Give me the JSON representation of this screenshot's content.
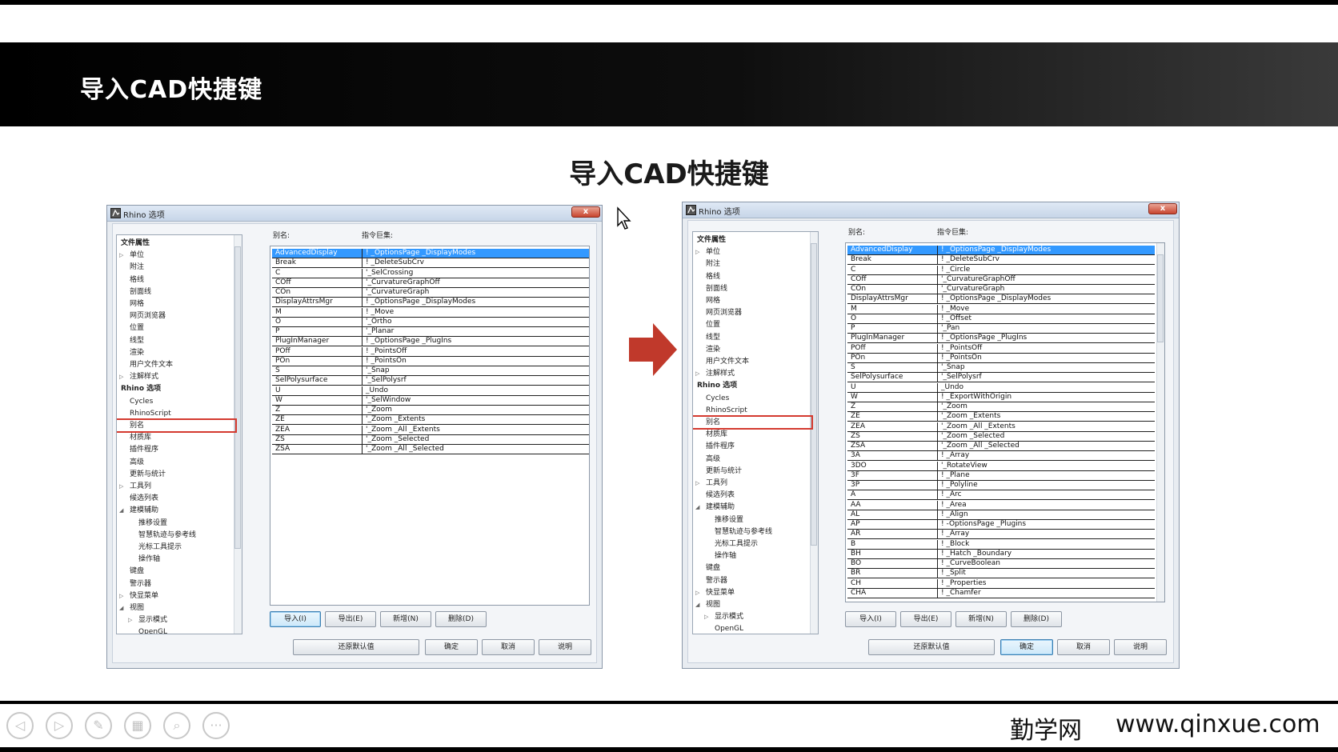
{
  "header": {
    "title": "导入CAD快捷键"
  },
  "slide": {
    "title": "导入CAD快捷键"
  },
  "dialog_title": "Rhino 选项",
  "close_glyph": "x",
  "column_headers": {
    "alias": "别名:",
    "macro": "指令巨集:"
  },
  "tree_items": [
    {
      "label": "文件属性",
      "bold": true
    },
    {
      "label": "单位",
      "indent": 1,
      "expander": "closed"
    },
    {
      "label": "附注",
      "indent": 1
    },
    {
      "label": "格线",
      "indent": 1
    },
    {
      "label": "剖面线",
      "indent": 1
    },
    {
      "label": "网格",
      "indent": 1
    },
    {
      "label": "网页浏览器",
      "indent": 1
    },
    {
      "label": "位置",
      "indent": 1
    },
    {
      "label": "线型",
      "indent": 1
    },
    {
      "label": "渲染",
      "indent": 1
    },
    {
      "label": "用户文件文本",
      "indent": 1
    },
    {
      "label": "注解样式",
      "indent": 1,
      "expander": "closed"
    },
    {
      "label": "Rhino 选项",
      "bold": true
    },
    {
      "label": "Cycles",
      "indent": 1
    },
    {
      "label": "RhinoScript",
      "indent": 1
    },
    {
      "label": "别名",
      "indent": 1,
      "selected": true
    },
    {
      "label": "材质库",
      "indent": 1
    },
    {
      "label": "插件程序",
      "indent": 1
    },
    {
      "label": "高级",
      "indent": 1
    },
    {
      "label": "更新与统计",
      "indent": 1
    },
    {
      "label": "工具列",
      "indent": 1,
      "expander": "closed"
    },
    {
      "label": "候选列表",
      "indent": 1
    },
    {
      "label": "建模辅助",
      "indent": 1,
      "expander": "open"
    },
    {
      "label": "推移设置",
      "indent": 2
    },
    {
      "label": "智慧轨迹与参考线",
      "indent": 2
    },
    {
      "label": "光标工具提示",
      "indent": 2
    },
    {
      "label": "操作轴",
      "indent": 2
    },
    {
      "label": "键盘",
      "indent": 1
    },
    {
      "label": "警示器",
      "indent": 1
    },
    {
      "label": "快显菜单",
      "indent": 1,
      "expander": "closed"
    },
    {
      "label": "视图",
      "indent": 1,
      "expander": "open"
    },
    {
      "label": "显示模式",
      "indent": 2,
      "expander": "closed"
    },
    {
      "label": "OpenGL",
      "indent": 2
    }
  ],
  "left_aliases": [
    [
      "AdvancedDisplay",
      "! _OptionsPage _DisplayModes"
    ],
    [
      "Break",
      "! _DeleteSubCrv"
    ],
    [
      "C",
      "'_SelCrossing"
    ],
    [
      "COff",
      "'_CurvatureGraphOff"
    ],
    [
      "COn",
      "'_CurvatureGraph"
    ],
    [
      "DisplayAttrsMgr",
      "! _OptionsPage _DisplayModes"
    ],
    [
      "M",
      "! _Move"
    ],
    [
      "O",
      "'_Ortho"
    ],
    [
      "P",
      "'_Planar"
    ],
    [
      "PlugInManager",
      "! _OptionsPage _PlugIns"
    ],
    [
      "POff",
      "! _PointsOff"
    ],
    [
      "POn",
      "! _PointsOn"
    ],
    [
      "S",
      "'_Snap"
    ],
    [
      "SelPolysurface",
      "'_SelPolysrf"
    ],
    [
      "U",
      "_Undo"
    ],
    [
      "W",
      "'_SelWindow"
    ],
    [
      "Z",
      "'_Zoom"
    ],
    [
      "ZE",
      "'_Zoom _Extents"
    ],
    [
      "ZEA",
      "'_Zoom _All _Extents"
    ],
    [
      "ZS",
      "'_Zoom _Selected"
    ],
    [
      "ZSA",
      "'_Zoom _All _Selected"
    ]
  ],
  "right_aliases": [
    [
      "AdvancedDisplay",
      "! _OptionsPage _DisplayModes"
    ],
    [
      "Break",
      "! _DeleteSubCrv"
    ],
    [
      "C",
      "! _Circle"
    ],
    [
      "COff",
      "'_CurvatureGraphOff"
    ],
    [
      "COn",
      "'_CurvatureGraph"
    ],
    [
      "DisplayAttrsMgr",
      "! _OptionsPage _DisplayModes"
    ],
    [
      "M",
      "! _Move"
    ],
    [
      "O",
      "! _Offset"
    ],
    [
      "P",
      "'_Pan"
    ],
    [
      "PlugInManager",
      "! _OptionsPage _PlugIns"
    ],
    [
      "POff",
      "! _PointsOff"
    ],
    [
      "POn",
      "! _PointsOn"
    ],
    [
      "S",
      "'_Snap"
    ],
    [
      "SelPolysurface",
      "'_SelPolysrf"
    ],
    [
      "U",
      "_Undo"
    ],
    [
      "W",
      "! _ExportWithOrigin"
    ],
    [
      "Z",
      "'_Zoom"
    ],
    [
      "ZE",
      "'_Zoom _Extents"
    ],
    [
      "ZEA",
      "'_Zoom _All _Extents"
    ],
    [
      "ZS",
      "'_Zoom _Selected"
    ],
    [
      "ZSA",
      "'_Zoom _All _Selected"
    ],
    [
      "3A",
      "! _Array"
    ],
    [
      "3DO",
      "'_RotateView"
    ],
    [
      "3F",
      "! _Plane"
    ],
    [
      "3P",
      "! _Polyline"
    ],
    [
      "A",
      "! _Arc"
    ],
    [
      "AA",
      "! _Area"
    ],
    [
      "AL",
      "! _Align"
    ],
    [
      "AP",
      "! -OptionsPage _Plugins"
    ],
    [
      "AR",
      "! _Array"
    ],
    [
      "B",
      "! _Block"
    ],
    [
      "BH",
      "! _Hatch _Boundary"
    ],
    [
      "BO",
      "! _CurveBoolean"
    ],
    [
      "BR",
      "! _Split"
    ],
    [
      "CH",
      "! _Properties"
    ],
    [
      "CHA",
      "! _Chamfer"
    ]
  ],
  "actions": {
    "import": "导入(I)",
    "export": "导出(E)",
    "new": "新增(N)",
    "delete": "删除(D)"
  },
  "dialog_buttons": {
    "restore": "还原默认值",
    "ok": "确定",
    "cancel": "取消",
    "help": "说明"
  },
  "nav_icons": [
    {
      "name": "prev-icon",
      "glyph": "◁"
    },
    {
      "name": "next-icon",
      "glyph": "▷"
    },
    {
      "name": "pen-icon",
      "glyph": "✎"
    },
    {
      "name": "slides-icon",
      "glyph": "▦"
    },
    {
      "name": "zoom-icon",
      "glyph": "⌕"
    },
    {
      "name": "more-icon",
      "glyph": "···"
    }
  ],
  "branding": {
    "name": "勤学网",
    "url": "www.qinxue.com"
  },
  "colors": {
    "accent_arrow": "#c0392b",
    "selection": "#3399ff",
    "highlight_box": "#d43a2f"
  }
}
